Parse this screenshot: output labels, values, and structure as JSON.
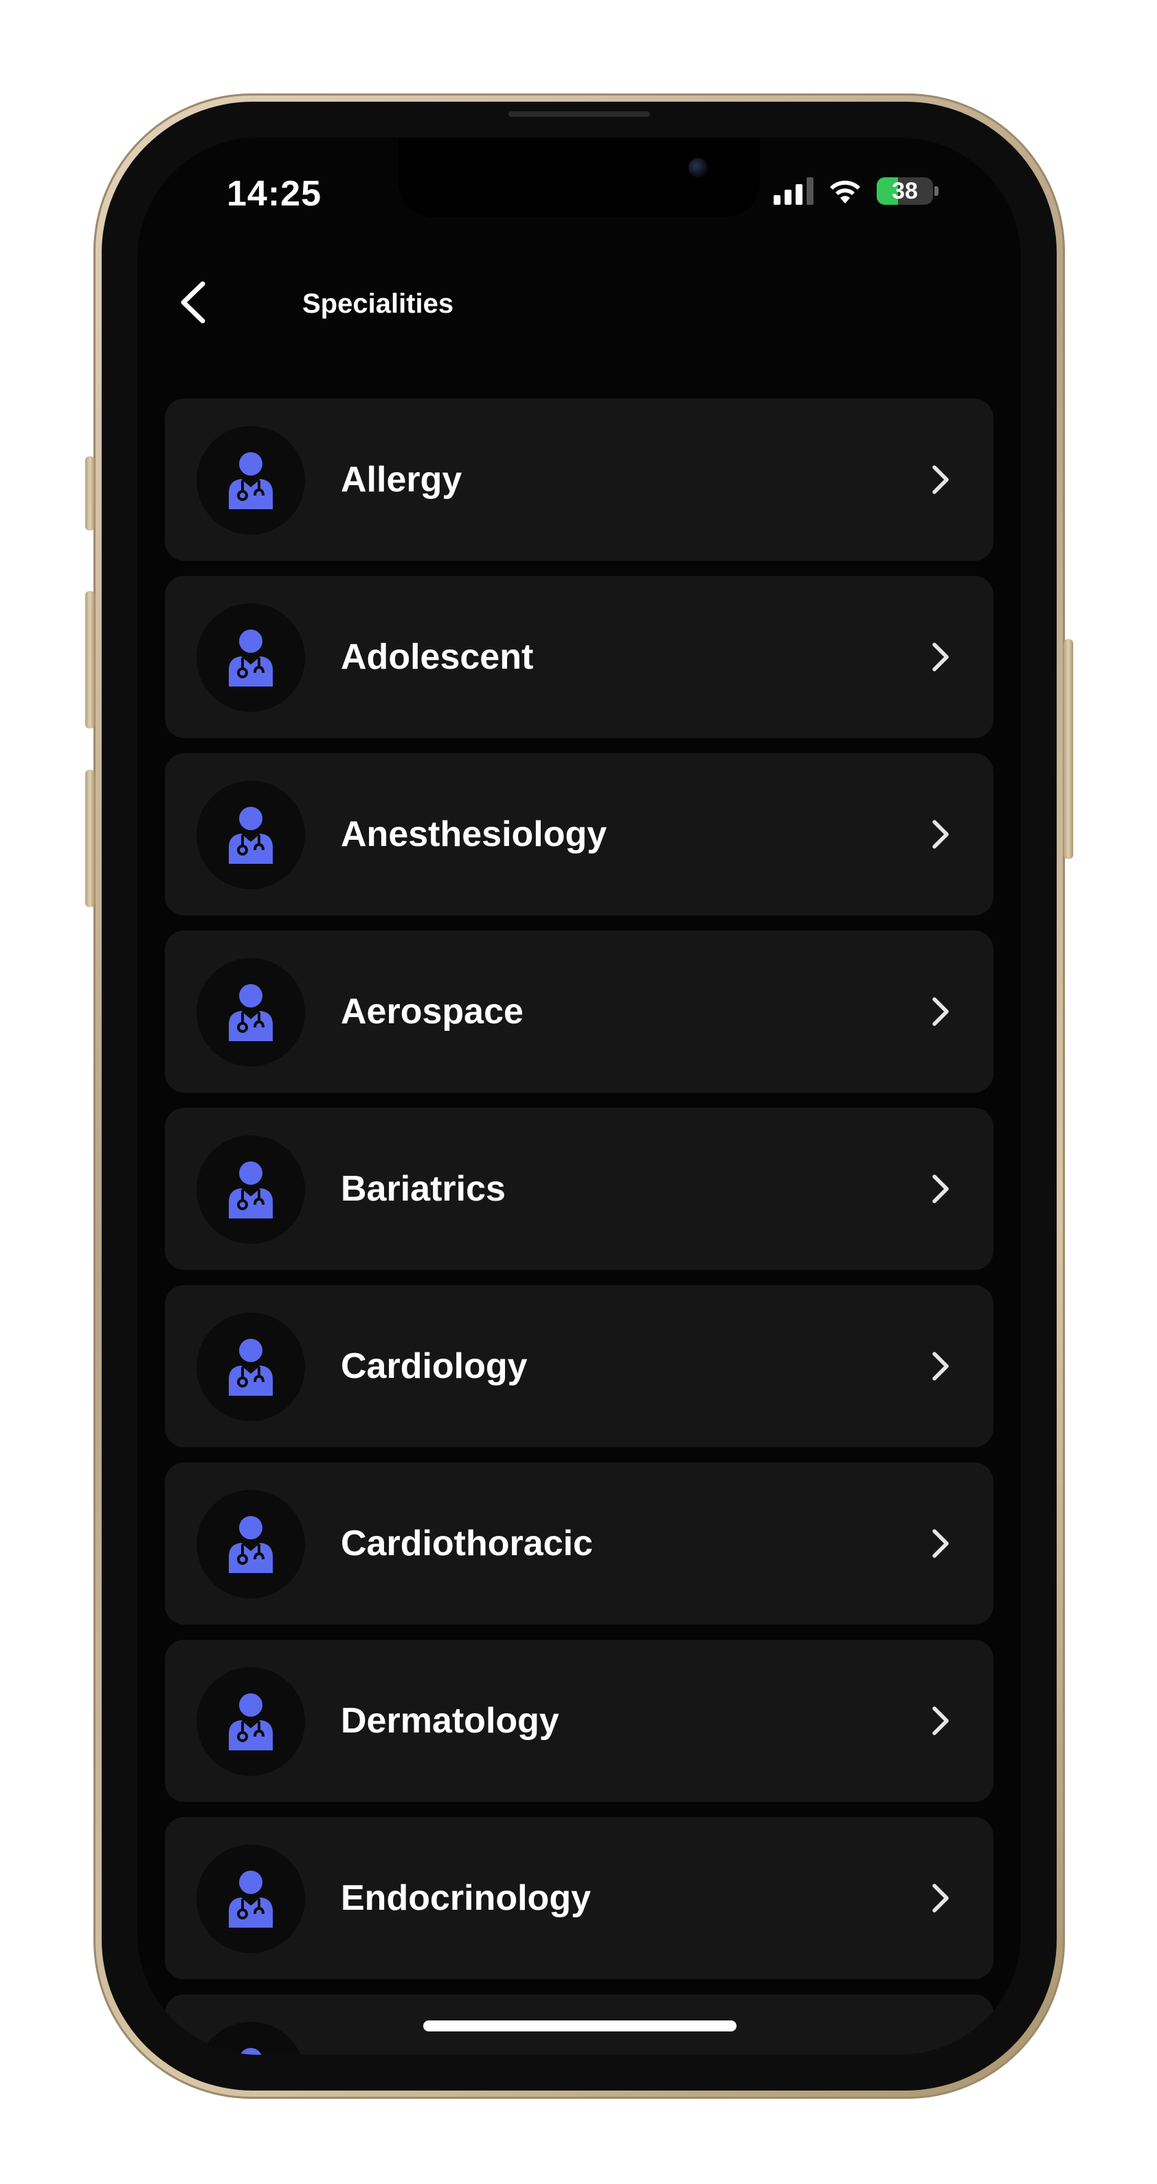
{
  "status_bar": {
    "time": "14:25",
    "battery": "38",
    "battery_level": 0.38
  },
  "header": {
    "title": "Specialities",
    "back_icon": "chevron-left-icon"
  },
  "specialities": [
    {
      "label": "Allergy",
      "icon": "doctor-icon"
    },
    {
      "label": "Adolescent",
      "icon": "doctor-icon"
    },
    {
      "label": "Anesthesiology",
      "icon": "doctor-icon"
    },
    {
      "label": "Aerospace",
      "icon": "doctor-icon"
    },
    {
      "label": "Bariatrics",
      "icon": "doctor-icon"
    },
    {
      "label": "Cardiology",
      "icon": "doctor-icon"
    },
    {
      "label": "Cardiothoracic",
      "icon": "doctor-icon"
    },
    {
      "label": "Dermatology",
      "icon": "doctor-icon"
    },
    {
      "label": "Endocrinology",
      "icon": "doctor-icon"
    },
    {
      "label": "",
      "icon": "doctor-icon"
    }
  ],
  "colors": {
    "accent": "#5b6cf0",
    "card": "#161616",
    "background": "#050505",
    "text": "#ffffff",
    "battery_fill": "#35c759"
  }
}
